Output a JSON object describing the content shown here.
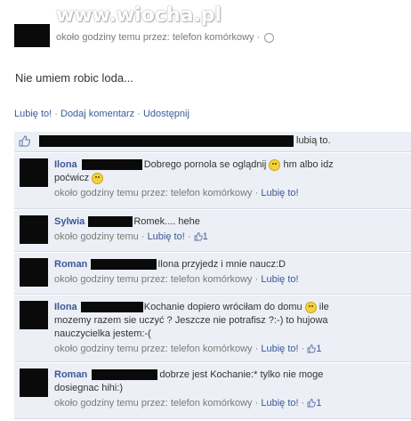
{
  "watermark": "www.wiocha.pl",
  "post": {
    "meta": "około godziny temu przez: telefon komórkowy ·",
    "message": "Nie umiem robic loda..."
  },
  "actions": {
    "like": "Lubię to!",
    "comment": "Dodaj komentarz",
    "share": "Udostępnij",
    "sep": "·"
  },
  "likes_summary": {
    "suffix": "lubią to."
  },
  "comments": [
    {
      "name": "Ilona",
      "text1": "Dobrego pornola se oglądnij",
      "text2": "hm albo idz",
      "text3": "poćwicz",
      "meta": "około godziny temu przez: telefon komórkowy ·",
      "like": "Lubię to!"
    },
    {
      "name": "Sylwia",
      "text1": "Romek.... hehe",
      "meta": "około godziny temu ·",
      "like": "Lubię to!",
      "sep": "·",
      "likes_count": "1"
    },
    {
      "name": "Roman",
      "text1": "Ilona przyjedz i mnie naucz:D",
      "meta": "około godziny temu przez: telefon komórkowy ·",
      "like": "Lubię to!"
    },
    {
      "name": "Ilona",
      "text1": "Kochanie dopiero wróciłam do domu",
      "text2": "ile",
      "text3": "mozemy razem sie uczyć ? Jeszcze nie potrafisz ?:-) to hujowa",
      "text4": "nauczycielka jestem:-(",
      "meta": "około godziny temu przez: telefon komórkowy ·",
      "like": "Lubię to!",
      "sep": "·",
      "likes_count": "1"
    },
    {
      "name": "Roman",
      "text1": "dobrze jest Kochanie:* tylko nie moge",
      "text2": "dosiegnac hihi:)",
      "meta": "około godziny temu przez: telefon komórkowy ·",
      "like": "Lubię to!",
      "sep": "·",
      "likes_count": "1"
    }
  ],
  "colors": {
    "link": "#3b5998",
    "comment_bg": "#eceff5"
  }
}
